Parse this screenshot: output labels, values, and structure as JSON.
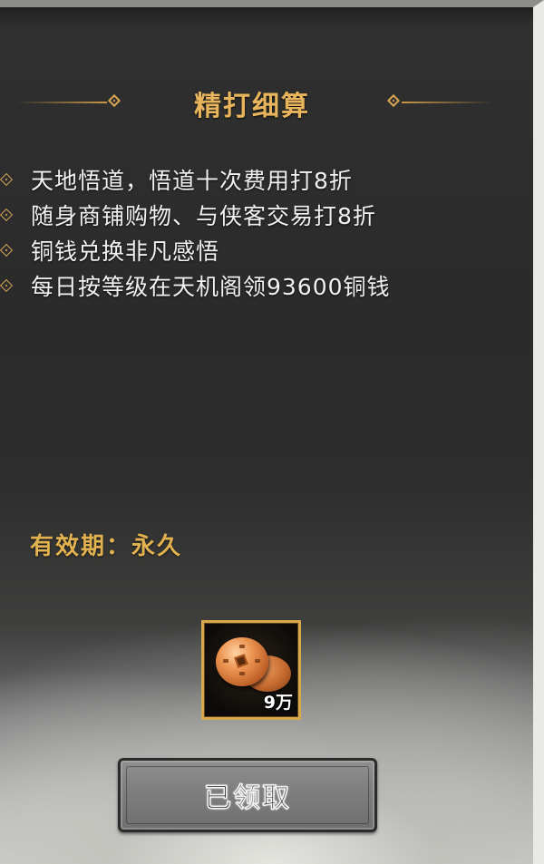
{
  "title": "精打细算",
  "benefits": [
    "天地悟道，悟道十次费用打8折",
    "随身商铺购物、与侠客交易打8折",
    "铜钱兑换非凡感悟",
    "每日按等级在天机阁领93600铜钱"
  ],
  "validity": {
    "text": "有效期：永久"
  },
  "reward": {
    "icon": "copper-coin-icon",
    "quantity": "9万"
  },
  "button": {
    "label": "已领取",
    "state": "claimed"
  },
  "colors": {
    "accent_gold": "#e8b55c",
    "validity_gold": "#e2b251",
    "text_light": "#f1f1ef",
    "button_gray": "#7d7e7d"
  }
}
